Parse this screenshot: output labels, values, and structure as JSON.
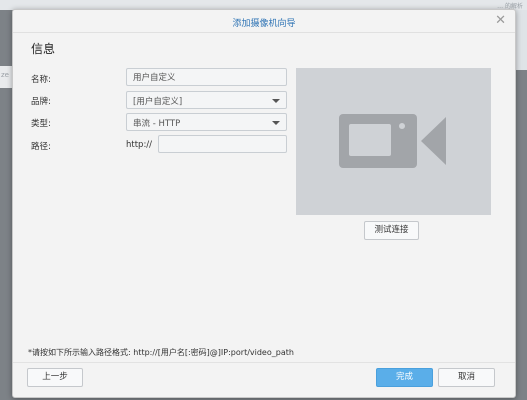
{
  "background": {
    "corner_text": "… 的解析",
    "left_text": "ze"
  },
  "dialog": {
    "title": "添加摄像机向导",
    "section_title": "信息",
    "form": {
      "name_label": "名称:",
      "name_value": "用户自定义",
      "brand_label": "品牌:",
      "brand_value": "[用户自定义]",
      "type_label": "类型:",
      "type_value": "串流 - HTTP",
      "path_label": "路径:",
      "path_prefix": "http://",
      "path_value": ""
    },
    "test_button": "测试连接",
    "hint": "*请按如下所示输入路径格式: http://[用户名[:密码]@]IP:port/video_path",
    "footer": {
      "back": "上一步",
      "finish": "完成",
      "cancel": "取消"
    }
  },
  "colors": {
    "accent": "#2f74b5",
    "primary_button": "#5aaee9",
    "preview_bg": "#cfd2d6",
    "camera_icon": "#a2a5a9"
  },
  "icons": {
    "close": "close-icon",
    "dropdown": "chevron-down-icon",
    "preview": "video-camera-icon"
  }
}
